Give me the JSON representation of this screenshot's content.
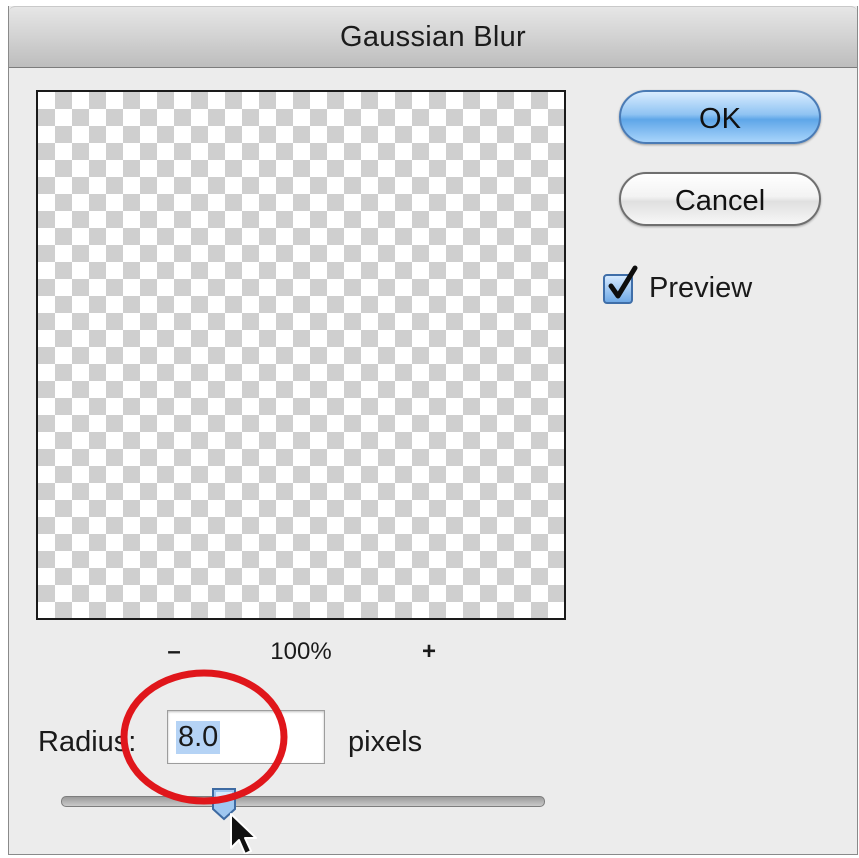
{
  "window": {
    "title": "Gaussian Blur"
  },
  "buttons": {
    "ok_label": "OK",
    "cancel_label": "Cancel"
  },
  "preview_option": {
    "label": "Preview",
    "checked": true
  },
  "zoom": {
    "minus": "–",
    "level": "100%",
    "plus": "+"
  },
  "radius": {
    "label": "Radius:",
    "value": "8.0",
    "unit": "pixels"
  },
  "annotation": {
    "highlight_color": "#e0161b"
  },
  "colors": {
    "default_button_accent": "#5ea6e8",
    "dialog_background": "#ececec"
  }
}
